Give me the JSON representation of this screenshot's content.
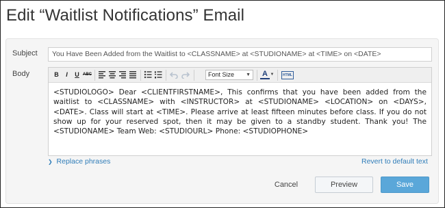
{
  "page": {
    "title": "Edit “Waitlist Notifications” Email"
  },
  "form": {
    "subject_label": "Subject",
    "subject_value": "You Have Been Added from the Waitlist to <CLASSNAME> at <STUDIONAME> at <TIME> on <DATE>",
    "body_label": "Body",
    "body_value": "<STUDIOLOGO> Dear <CLIENTFIRSTNAME>, This confirms that you have been added from the waitlist to <CLASSNAME> with <INSTRUCTOR> at <STUDIONAME> <LOCATION> on <DAYS>, <DATE>. Class will start at <TIME>. Please arrive at least fifteen minutes before class. If you do not show up for your reserved spot, then it may be given to a standby student. Thank you! The <STUDIONAME> Team Web: <STUDIOURL> Phone: <STUDIOPHONE>"
  },
  "toolbar": {
    "bold": "B",
    "italic": "I",
    "underline": "U",
    "strike": "ABC",
    "font_size": "Font Size",
    "font_color": "A",
    "html": "HTML",
    "icons": [
      "bold-icon",
      "italic-icon",
      "underline-icon",
      "strikethrough-icon",
      "align-left-icon",
      "align-center-icon",
      "align-right-icon",
      "align-justify-icon",
      "bullet-list-icon",
      "numbered-list-icon",
      "undo-icon",
      "redo-icon",
      "font-color-icon",
      "html-icon"
    ]
  },
  "links": {
    "replace_phrases": "Replace phrases",
    "revert": "Revert to default text"
  },
  "actions": {
    "cancel": "Cancel",
    "preview": "Preview",
    "save": "Save"
  },
  "colors": {
    "accent": "#5aa7d9",
    "link": "#2e7cb8",
    "panel": "#f5f5f5"
  }
}
